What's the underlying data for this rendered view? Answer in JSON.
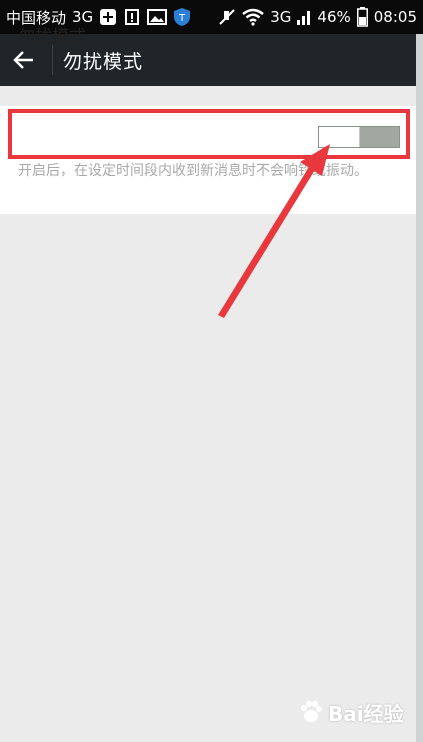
{
  "status_bar": {
    "carrier": "中国移动",
    "network": "3G",
    "right_network": "3G",
    "battery": "46%",
    "time": "08:05",
    "icons": [
      "plus-icon",
      "warning-icon",
      "image-icon",
      "shield-icon",
      "mute-icon",
      "wifi-icon",
      "signal-icon",
      "battery-icon"
    ]
  },
  "app_bar": {
    "title": "勿扰模式",
    "back_icon": "arrow-left-icon"
  },
  "setting": {
    "label": "勿扰模式",
    "toggle_on": false,
    "description": "开启后，在设定时间段内收到新消息时不会响铃或振动。"
  },
  "annotation": {
    "highlight_color": "#e8383d"
  },
  "watermark": {
    "text": "Bai经验"
  },
  "colors": {
    "app_bar": "#1f2528",
    "status_bar": "#0a0a0a",
    "background": "#ebebeb",
    "toggle_track": "#a2a8a1"
  }
}
